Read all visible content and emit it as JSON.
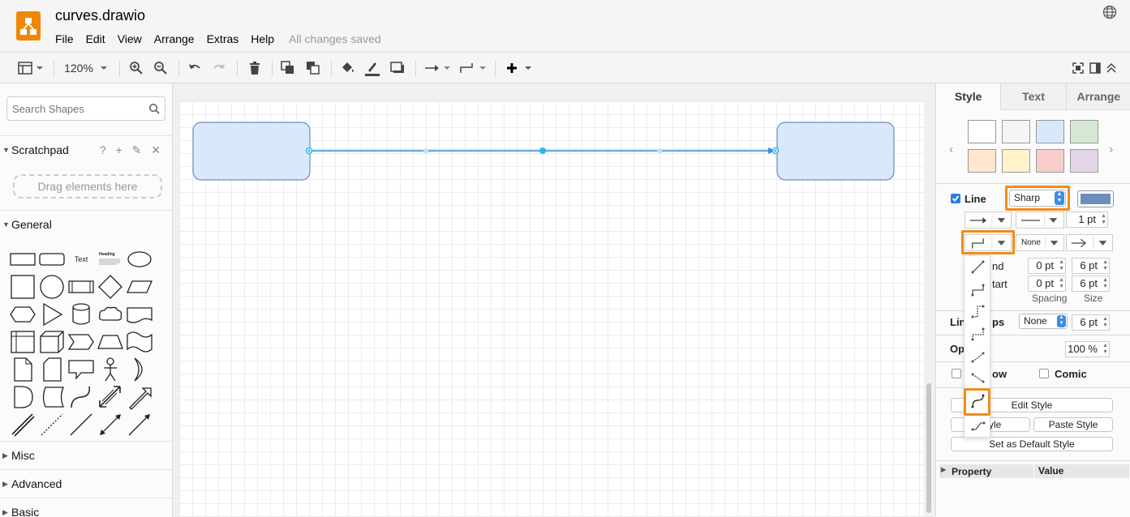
{
  "app": {
    "title": "curves.drawio",
    "save_status": "All changes saved"
  },
  "menu": [
    "File",
    "Edit",
    "View",
    "Arrange",
    "Extras",
    "Help"
  ],
  "toolbar": {
    "zoom": "120%"
  },
  "left_panel": {
    "search_placeholder": "Search Shapes",
    "scratchpad": {
      "title": "Scratchpad",
      "tools": "? + ✎ ✕",
      "drag_hint": "Drag elements here"
    },
    "sections": {
      "general": "General",
      "misc": "Misc",
      "advanced": "Advanced",
      "basic": "Basic"
    },
    "shape_labels": {
      "text": "Text",
      "heading": "Heading"
    }
  },
  "right_panel": {
    "tabs": [
      "Style",
      "Text",
      "Arrange"
    ],
    "colors": {
      "swatches": [
        "#ffffff",
        "#f5f5f5",
        "#dae8fc",
        "#d5e8d4",
        "#ffe6cc",
        "#fff2cc",
        "#f8cecc",
        "#e1d5e7"
      ],
      "line_color": "#6c8ebf",
      "accent": "#f08c1b",
      "selection": "#29b6f2"
    },
    "line": {
      "label": "Line",
      "style": "Sharp",
      "width": "1 pt",
      "line_start_marker": "None"
    },
    "end_row": {
      "label_partial": "nd",
      "spacing": "0 pt",
      "size": "6 pt"
    },
    "start_row": {
      "label_partial": "tart",
      "spacing": "0 pt",
      "size": "6 pt"
    },
    "spacing_header": "Spacing",
    "size_header": "Size",
    "line_jumps": {
      "label_left": "Lin",
      "label_right": "ps",
      "value": "None",
      "size": "6 pt"
    },
    "opacity": {
      "label_partial": "Op",
      "value": "100 %"
    },
    "shadow": {
      "label_partial": "ow"
    },
    "comic": {
      "label": "Comic"
    },
    "buttons": {
      "edit_style": "Edit Style",
      "copy_style_partial": "Style",
      "paste_style": "Paste Style",
      "set_default": "Set as Default Style"
    },
    "property_table": {
      "col1": "Property",
      "col2": "Value"
    }
  }
}
